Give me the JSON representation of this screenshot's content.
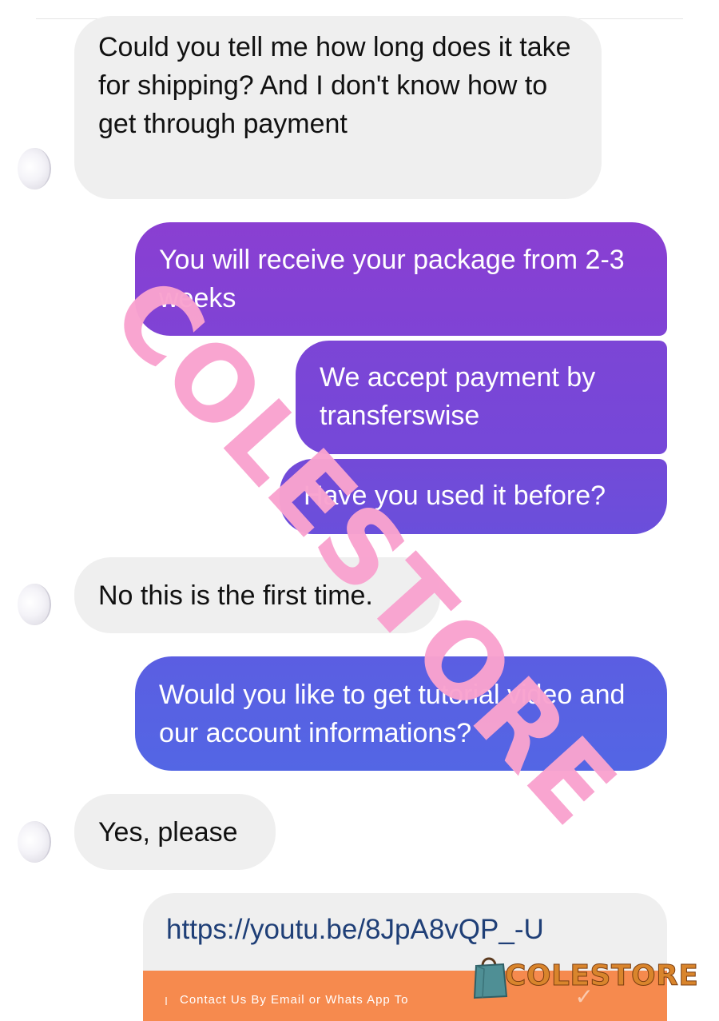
{
  "conversation": {
    "messages": [
      {
        "sender": "customer",
        "text": "Could you tell me how long does it take for shipping? And I don't know how to get through payment"
      },
      {
        "sender": "seller",
        "text": "You will receive your package from 2-3 weeks"
      },
      {
        "sender": "seller",
        "text": "We accept payment by transferswise"
      },
      {
        "sender": "seller",
        "text": "Have you used it before?"
      },
      {
        "sender": "customer",
        "text": "No this is the first time."
      },
      {
        "sender": "seller",
        "text": "Would you like to get tutorial video and our account informations?"
      },
      {
        "sender": "customer",
        "text": "Yes, please"
      }
    ],
    "link_card": {
      "url": "https://youtu.be/8JpA8vQP_-U",
      "preview_text": "Contact Us By Email or Whats App To"
    }
  },
  "watermark": {
    "text": "COLESTORE"
  },
  "brand": {
    "name": "COLESTORE"
  },
  "colors": {
    "incoming_bubble": "#efefef",
    "outgoing_gradient": [
      "#8a3fd2",
      "#5366e4"
    ],
    "watermark": "#f9a3cf",
    "link_text": "#1f3f77",
    "preview_bg": "#f68a4e"
  }
}
